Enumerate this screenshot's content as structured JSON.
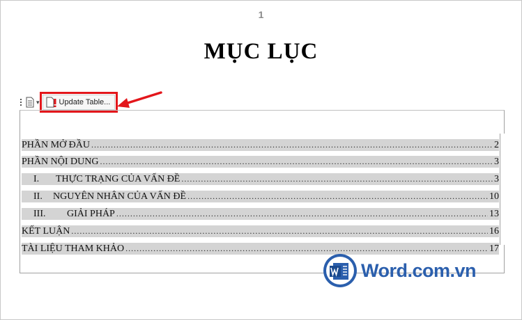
{
  "page": {
    "number": "1",
    "title": "MỤC LỤC"
  },
  "toolbar": {
    "update_label": "Update Table..."
  },
  "toc": {
    "entries": [
      {
        "num": "",
        "label": "PHẦN MỞ ĐẦU",
        "page": "2"
      },
      {
        "num": "",
        "label": "PHẦN NỘI DUNG",
        "page": "3"
      },
      {
        "num": "I.",
        "label": "THỰC TRẠNG CỦA VẤN ĐỀ",
        "page": "3"
      },
      {
        "num": "II.",
        "label": "NGUYÊN NHÂN CỦA VẤN ĐỀ",
        "page": "10"
      },
      {
        "num": "III.",
        "label": "GIẢI PHÁP",
        "page": "13"
      },
      {
        "num": "",
        "label": "KẾT LUẬN",
        "page": "16"
      },
      {
        "num": "",
        "label": "TÀI LIỆU THAM KHẢO",
        "page": "17"
      }
    ]
  },
  "watermark": {
    "text": "Word.com.vn"
  },
  "colors": {
    "highlight_red": "#e3161b",
    "brand_blue": "#2b5fad",
    "toc_shading": "#d4d4d4"
  }
}
